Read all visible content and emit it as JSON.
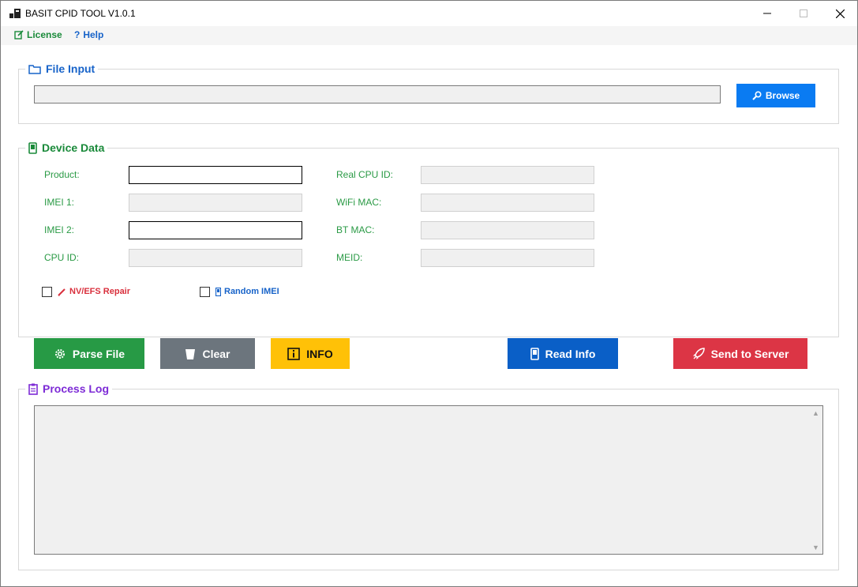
{
  "window": {
    "title": "BASIT CPID TOOL V1.0.1",
    "minimize": "—",
    "maximize": "☐",
    "close": "✕"
  },
  "menu": {
    "license": "License",
    "help": "Help"
  },
  "file_input": {
    "title": "File Input",
    "value": "",
    "browse_label": "Browse"
  },
  "device_data": {
    "title": "Device Data",
    "fields": {
      "product": {
        "label": "Product:",
        "value": ""
      },
      "imei1": {
        "label": "IMEI 1:",
        "value": ""
      },
      "imei2": {
        "label": "IMEI 2:",
        "value": ""
      },
      "cpu_id": {
        "label": "CPU ID:",
        "value": ""
      },
      "real_cpu_id": {
        "label": "Real CPU ID:",
        "value": ""
      },
      "wifi_mac": {
        "label": "WiFi MAC:",
        "value": ""
      },
      "bt_mac": {
        "label": "BT MAC:",
        "value": ""
      },
      "meid": {
        "label": "MEID:",
        "value": ""
      }
    },
    "nv_efs_repair": {
      "label": "NV/EFS Repair",
      "checked": false
    },
    "random_imei": {
      "label": "Random IMEI",
      "checked": false
    }
  },
  "actions": {
    "parse_file": "Parse File",
    "clear": "Clear",
    "info": "INFO",
    "read_info": "Read Info",
    "send_to_server": "Send to Server"
  },
  "process_log": {
    "title": "Process Log",
    "content": ""
  },
  "colors": {
    "green": "#279a45",
    "gray": "#6c757d",
    "yellow": "#ffc107",
    "blue": "#0a5fc7",
    "red": "#dc3545",
    "browse_blue": "#0a7bf2",
    "purple": "#7d2bd6"
  },
  "icons": {
    "app": "app-icon",
    "license": "license-icon",
    "help": "question-icon",
    "file_input": "folder-icon",
    "browse": "search-icon",
    "device": "device-icon",
    "nv": "pencil-icon",
    "random": "device-small-icon",
    "parse": "gear-icon",
    "clear": "trash-icon",
    "info": "info-icon",
    "read": "device-icon",
    "send": "rocket-icon",
    "log": "clipboard-icon"
  }
}
